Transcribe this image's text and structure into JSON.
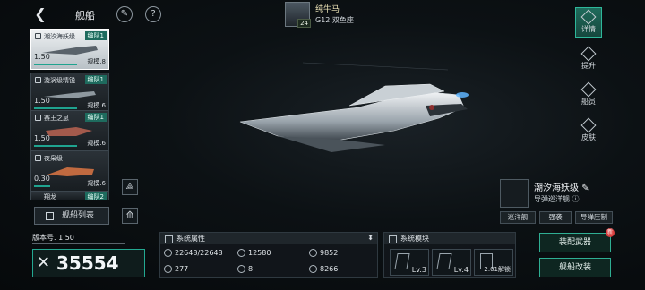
{
  "header": {
    "title": "舰船",
    "back_icon": "back-chevron-icon"
  },
  "player": {
    "name": "纯牛马",
    "level": "24",
    "info": "G12.双鱼座"
  },
  "fleet_list": [
    {
      "name": "潮汐海妖级",
      "tag": "编队1",
      "number": "1.50",
      "size": "规模.8",
      "selected": true
    },
    {
      "name": "漩涡级精锐",
      "tag": "编队1",
      "number": "1.50",
      "size": "规模.6",
      "selected": false
    },
    {
      "name": "赛王之息",
      "tag": "编队1",
      "number": "1.50",
      "size": "规模.6",
      "selected": false
    },
    {
      "name": "夜枭级",
      "tag": "",
      "number": "0.30",
      "size": "规模.6",
      "selected": false
    },
    {
      "name": "翔龙",
      "tag": "编队2",
      "number": "",
      "size": "",
      "selected": false
    }
  ],
  "list_button": "舰船列表",
  "version": "版本号. 1.50",
  "power": "35554",
  "stats_panel": {
    "title": "系统属性",
    "items": [
      {
        "value": "22648/22648",
        "icon": "hull-icon"
      },
      {
        "value": "12580",
        "icon": "attack-icon"
      },
      {
        "value": "9852",
        "icon": "shield-icon"
      },
      {
        "value": "277",
        "icon": "speed-icon"
      },
      {
        "value": "8",
        "icon": "grid-icon"
      },
      {
        "value": "8266",
        "icon": "armor-icon"
      }
    ]
  },
  "modules_panel": {
    "title": "系统模块",
    "modules": [
      {
        "label": "Lv.3"
      },
      {
        "label": "Lv.4"
      },
      {
        "label": "2.01解锁"
      }
    ]
  },
  "right_tabs": [
    {
      "label": "详情",
      "active": true
    },
    {
      "label": "提升",
      "active": false
    },
    {
      "label": "船员",
      "active": false
    },
    {
      "label": "皮肤",
      "active": false
    }
  ],
  "ship": {
    "name": "潮汐海妖级",
    "type": "导弹巡洋舰",
    "chips": [
      "巡洋舰",
      "强袭",
      "导弹压制"
    ]
  },
  "actions": {
    "equip": "装配武器",
    "refit": "舰船改装",
    "equip_badge": "新"
  },
  "colors": {
    "accent": "#2fae93",
    "tag_bg": "#1e6b5e",
    "name_gold": "#f0e6b8"
  }
}
